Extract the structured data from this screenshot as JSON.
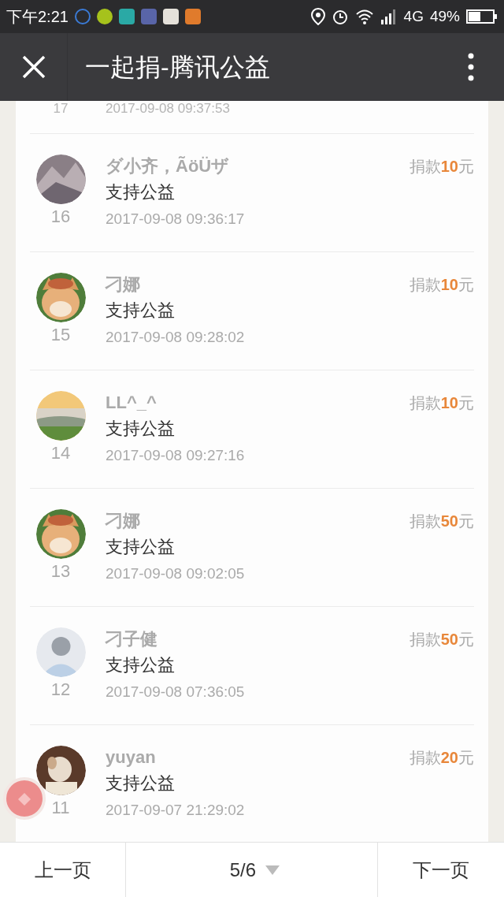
{
  "status_bar": {
    "time": "下午2:21",
    "network": "4G",
    "battery": "49%"
  },
  "header": {
    "title": "一起捐-腾讯公益"
  },
  "partial_row": {
    "rank": "17",
    "time": "2017-09-08 09:37:53"
  },
  "donations": [
    {
      "rank": "16",
      "name": "ダ小齐，ÃöÜザ",
      "message": "支持公益",
      "time": "2017-09-08 09:36:17",
      "prefix": "捐款",
      "amount": "10",
      "suffix": "元"
    },
    {
      "rank": "15",
      "name": "刁娜",
      "message": "支持公益",
      "time": "2017-09-08 09:28:02",
      "prefix": "捐款",
      "amount": "10",
      "suffix": "元"
    },
    {
      "rank": "14",
      "name": "LL^_^",
      "message": "支持公益",
      "time": "2017-09-08 09:27:16",
      "prefix": "捐款",
      "amount": "10",
      "suffix": "元"
    },
    {
      "rank": "13",
      "name": "刁娜",
      "message": "支持公益",
      "time": "2017-09-08 09:02:05",
      "prefix": "捐款",
      "amount": "50",
      "suffix": "元"
    },
    {
      "rank": "12",
      "name": "刁子健",
      "message": "支持公益",
      "time": "2017-09-08 07:36:05",
      "prefix": "捐款",
      "amount": "50",
      "suffix": "元"
    },
    {
      "rank": "11",
      "name": "yuyan",
      "message": "支持公益",
      "time": "2017-09-07 21:29:02",
      "prefix": "捐款",
      "amount": "20",
      "suffix": "元"
    }
  ],
  "pager": {
    "prev": "上一页",
    "page": "5/6",
    "next": "下一页"
  }
}
